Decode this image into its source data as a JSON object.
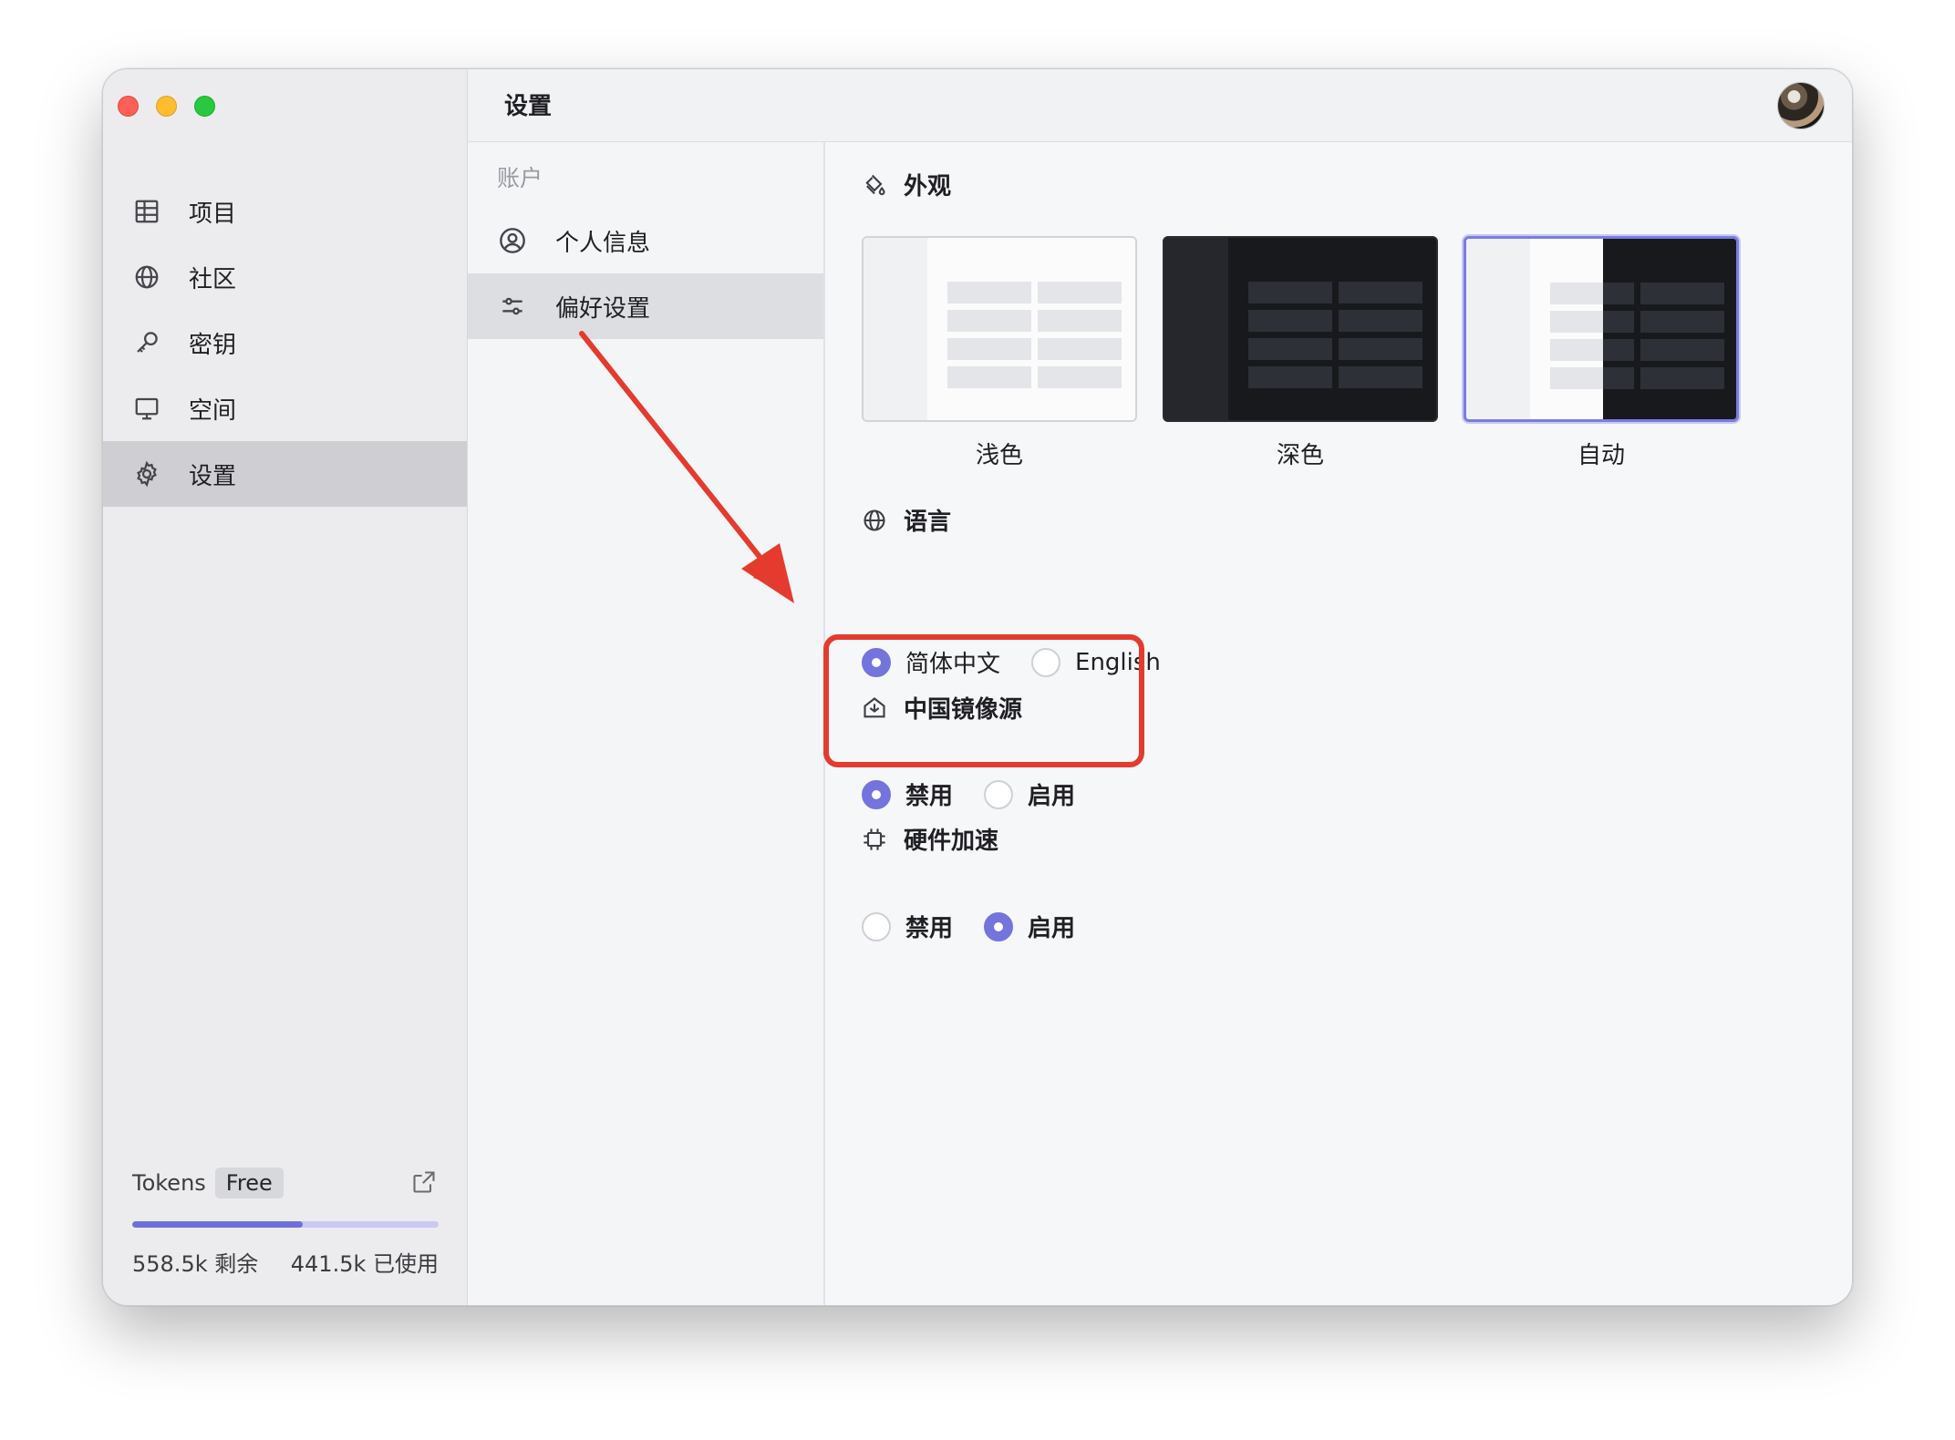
{
  "sidebar": {
    "items": [
      {
        "label": "项目",
        "icon": "table-icon"
      },
      {
        "label": "社区",
        "icon": "globe-icon"
      },
      {
        "label": "密钥",
        "icon": "key-icon"
      },
      {
        "label": "空间",
        "icon": "monitor-icon"
      },
      {
        "label": "设置",
        "icon": "gear-icon",
        "active": true
      }
    ],
    "tokens": {
      "label": "Tokens",
      "plan": "Free",
      "remaining": "558.5k 剩余",
      "used": "441.5k 已使用",
      "progress_fraction": 0.558
    }
  },
  "header": {
    "title": "设置"
  },
  "subnav": {
    "group": "账户",
    "items": [
      {
        "label": "个人信息",
        "icon": "user-circle-icon"
      },
      {
        "label": "偏好设置",
        "icon": "sliders-icon",
        "active": true
      }
    ]
  },
  "settings": {
    "appearance": {
      "title": "外观",
      "options": [
        {
          "label": "浅色",
          "selected": false
        },
        {
          "label": "深色",
          "selected": false
        },
        {
          "label": "自动",
          "selected": true
        }
      ]
    },
    "language": {
      "title": "语言",
      "options": [
        {
          "label": "简体中文",
          "checked": true
        },
        {
          "label": "English",
          "checked": false
        }
      ]
    },
    "mirror": {
      "title": "中国镜像源",
      "options": [
        {
          "label": "禁用",
          "checked": true
        },
        {
          "label": "启用",
          "checked": false
        }
      ]
    },
    "hardware": {
      "title": "硬件加速",
      "options": [
        {
          "label": "禁用",
          "checked": false
        },
        {
          "label": "启用",
          "checked": true
        }
      ]
    }
  },
  "colors": {
    "accent": "#7374dc",
    "annotation": "#e53b2f",
    "sidebar_bg": "#ececee",
    "active_item_bg": "#cfcfd3"
  }
}
